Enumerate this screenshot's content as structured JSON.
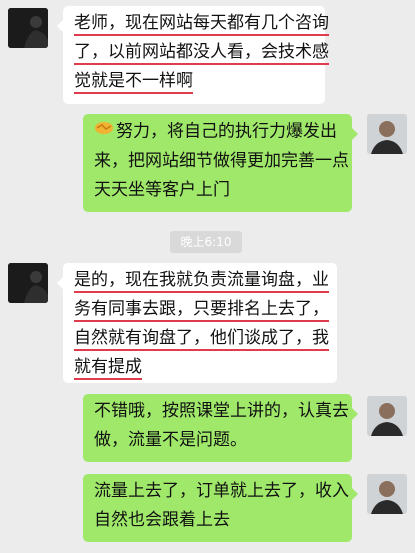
{
  "messages": [
    {
      "id": "m1",
      "direction": "incoming",
      "lines": [
        "老师，现在网站每天都有几个咨询",
        "了，以前网站都没人看，会技术感",
        "觉就是不一样啊"
      ]
    },
    {
      "id": "m2",
      "direction": "outgoing",
      "emoji": "handshake-emoji",
      "lines": [
        "努力，将自己的执行力爆发出",
        "来，把网站细节做得更加完善一点",
        "天天坐等客户上门"
      ]
    },
    {
      "id": "m3",
      "direction": "incoming",
      "lines": [
        "是的，现在我就负责流量询盘，业",
        "务有同事去跟，只要排名上去了，",
        "自然就有询盘了，他们谈成了，我",
        "就有提成"
      ]
    },
    {
      "id": "m4",
      "direction": "outgoing",
      "lines": [
        "不错哦，按照课堂上讲的，认真去",
        "做，流量不是问题。"
      ]
    },
    {
      "id": "m5",
      "direction": "outgoing",
      "lines": [
        "流量上去了，订单就上去了，收入",
        "自然也会跟着上去"
      ]
    }
  ],
  "timestamp": "晚上6:10",
  "colors": {
    "outgoing_bubble": "#9fe86a",
    "incoming_bubble": "#ffffff",
    "underline": "#e03c4e",
    "background": "#ececec"
  }
}
